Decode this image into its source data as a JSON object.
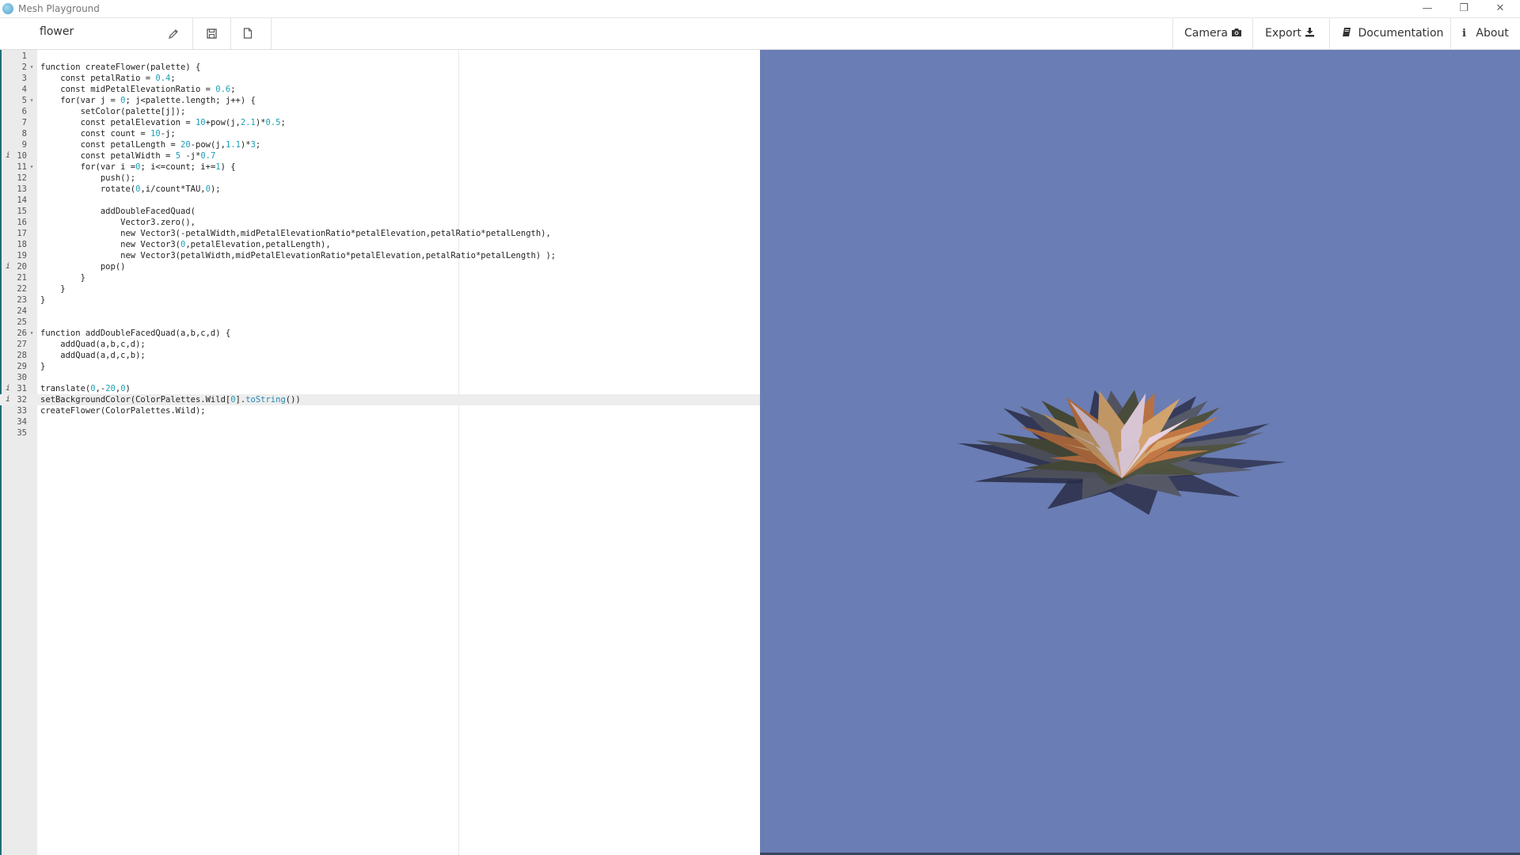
{
  "window": {
    "title": "Mesh Playground",
    "controls": [
      "minimize",
      "restore",
      "close"
    ]
  },
  "toolbar": {
    "filename": "flower",
    "icons": [
      "pencil-icon",
      "save-icon",
      "new-file-icon"
    ],
    "menu": [
      {
        "label": "Camera",
        "icon": "camera-icon"
      },
      {
        "label": "Export",
        "icon": "download-icon"
      },
      {
        "label": "Documentation",
        "icon": "book-icon"
      },
      {
        "label": "About",
        "icon": "info-icon"
      }
    ]
  },
  "editor": {
    "active_line": 32,
    "lines": [
      {
        "n": 1,
        "text": ""
      },
      {
        "n": 2,
        "text": "function createFlower(palette) {",
        "fold": true
      },
      {
        "n": 3,
        "text": "    const petalRatio = 0.4;"
      },
      {
        "n": 4,
        "text": "    const midPetalElevationRatio = 0.6;"
      },
      {
        "n": 5,
        "text": "    for(var j = 0; j<palette.length; j++) {",
        "fold": true
      },
      {
        "n": 6,
        "text": "        setColor(palette[j]);"
      },
      {
        "n": 7,
        "text": "        const petalElevation = 10+pow(j,2.1)*0.5;"
      },
      {
        "n": 8,
        "text": "        const count = 10-j;"
      },
      {
        "n": 9,
        "text": "        const petalLength = 20-pow(j,1.1)*3;"
      },
      {
        "n": 10,
        "text": "        const petalWidth = 5 -j*0.7",
        "info": true
      },
      {
        "n": 11,
        "text": "        for(var i =0; i<=count; i+=1) {",
        "fold": true
      },
      {
        "n": 12,
        "text": "            push();"
      },
      {
        "n": 13,
        "text": "            rotate(0,i/count*TAU,0);"
      },
      {
        "n": 14,
        "text": ""
      },
      {
        "n": 15,
        "text": "            addDoubleFacedQuad("
      },
      {
        "n": 16,
        "text": "                Vector3.zero(),"
      },
      {
        "n": 17,
        "text": "                new Vector3(-petalWidth,midPetalElevationRatio*petalElevation,petalRatio*petalLength),"
      },
      {
        "n": 18,
        "text": "                new Vector3(0,petalElevation,petalLength),"
      },
      {
        "n": 19,
        "text": "                new Vector3(petalWidth,midPetalElevationRatio*petalElevation,petalRatio*petalLength) );"
      },
      {
        "n": 20,
        "text": "            pop()",
        "info": true
      },
      {
        "n": 21,
        "text": "        }"
      },
      {
        "n": 22,
        "text": "    }"
      },
      {
        "n": 23,
        "text": "}"
      },
      {
        "n": 24,
        "text": ""
      },
      {
        "n": 25,
        "text": ""
      },
      {
        "n": 26,
        "text": "function addDoubleFacedQuad(a,b,c,d) {",
        "fold": true
      },
      {
        "n": 27,
        "text": "    addQuad(a,b,c,d);"
      },
      {
        "n": 28,
        "text": "    addQuad(a,d,c,b);"
      },
      {
        "n": 29,
        "text": "}"
      },
      {
        "n": 30,
        "text": ""
      },
      {
        "n": 31,
        "text": "translate(0,-20,0)",
        "info": true
      },
      {
        "n": 32,
        "text": "setBackgroundColor(ColorPalettes.Wild[0].toString())",
        "info": true
      },
      {
        "n": 33,
        "text": "createFlower(ColorPalettes.Wild);"
      },
      {
        "n": 34,
        "text": ""
      },
      {
        "n": 35,
        "text": ""
      }
    ]
  },
  "viewport": {
    "background": "#6a7db4",
    "petal_colors": [
      "#2f3350",
      "#5a5d6b",
      "#4f5340",
      "#c47846",
      "#d8a870",
      "#e6d2e2"
    ]
  }
}
